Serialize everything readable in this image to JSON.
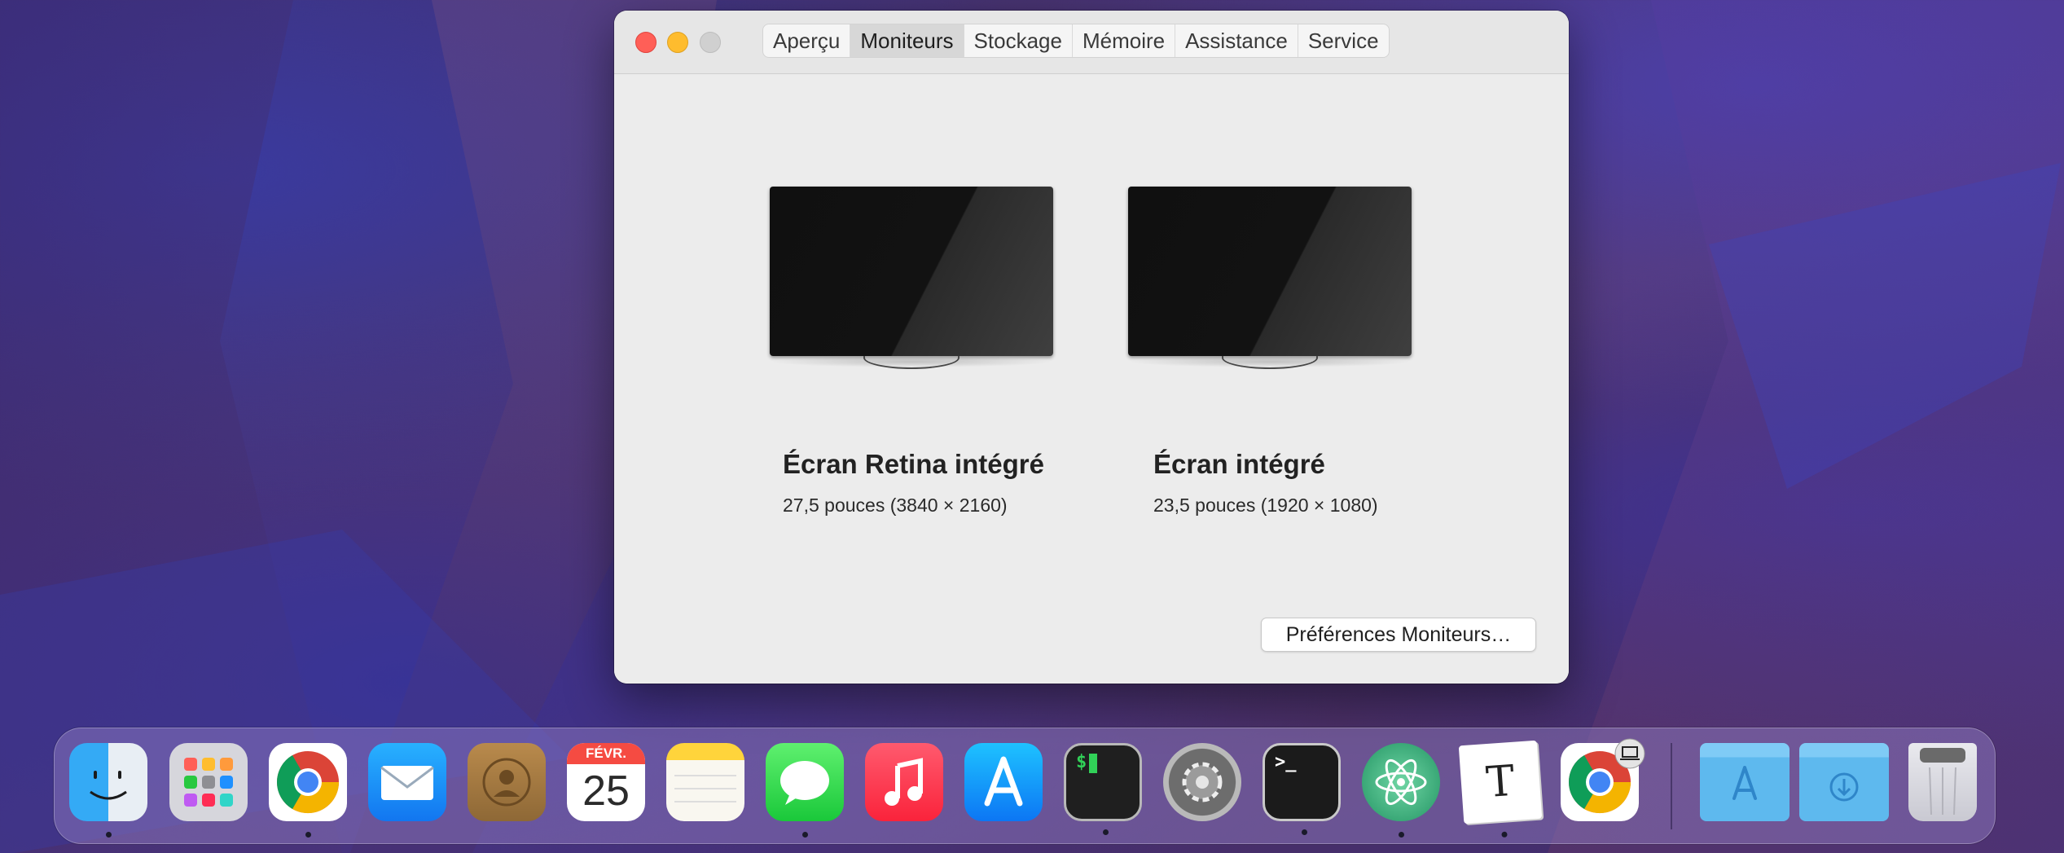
{
  "window": {
    "tabs": [
      "Aperçu",
      "Moniteurs",
      "Stockage",
      "Mémoire",
      "Assistance",
      "Service"
    ],
    "active_tab": "Moniteurs",
    "displays": [
      {
        "name": "Écran Retina intégré",
        "description": "27,5 pouces (3840 × 2160)"
      },
      {
        "name": "Écran intégré",
        "description": "23,5 pouces (1920 × 1080)"
      }
    ],
    "preferences_button": "Préférences Moniteurs…"
  },
  "dock": {
    "calendar_month": "FÉVR.",
    "calendar_day": "25",
    "terminal_prompt": "$",
    "terminal2_prompt": ">_",
    "typora_letter": "T",
    "items": [
      "finder",
      "launchpad",
      "chrome",
      "mail",
      "contacts",
      "calendar",
      "notes",
      "messages",
      "music",
      "app-store",
      "terminal",
      "system-preferences",
      "terminal",
      "atom",
      "typora",
      "chrome",
      "applications-folder",
      "downloads-folder",
      "trash"
    ]
  },
  "colors": {
    "close": "#ff5f57",
    "minimize": "#febc2e",
    "zoom_disabled": "#d0d0d0"
  }
}
